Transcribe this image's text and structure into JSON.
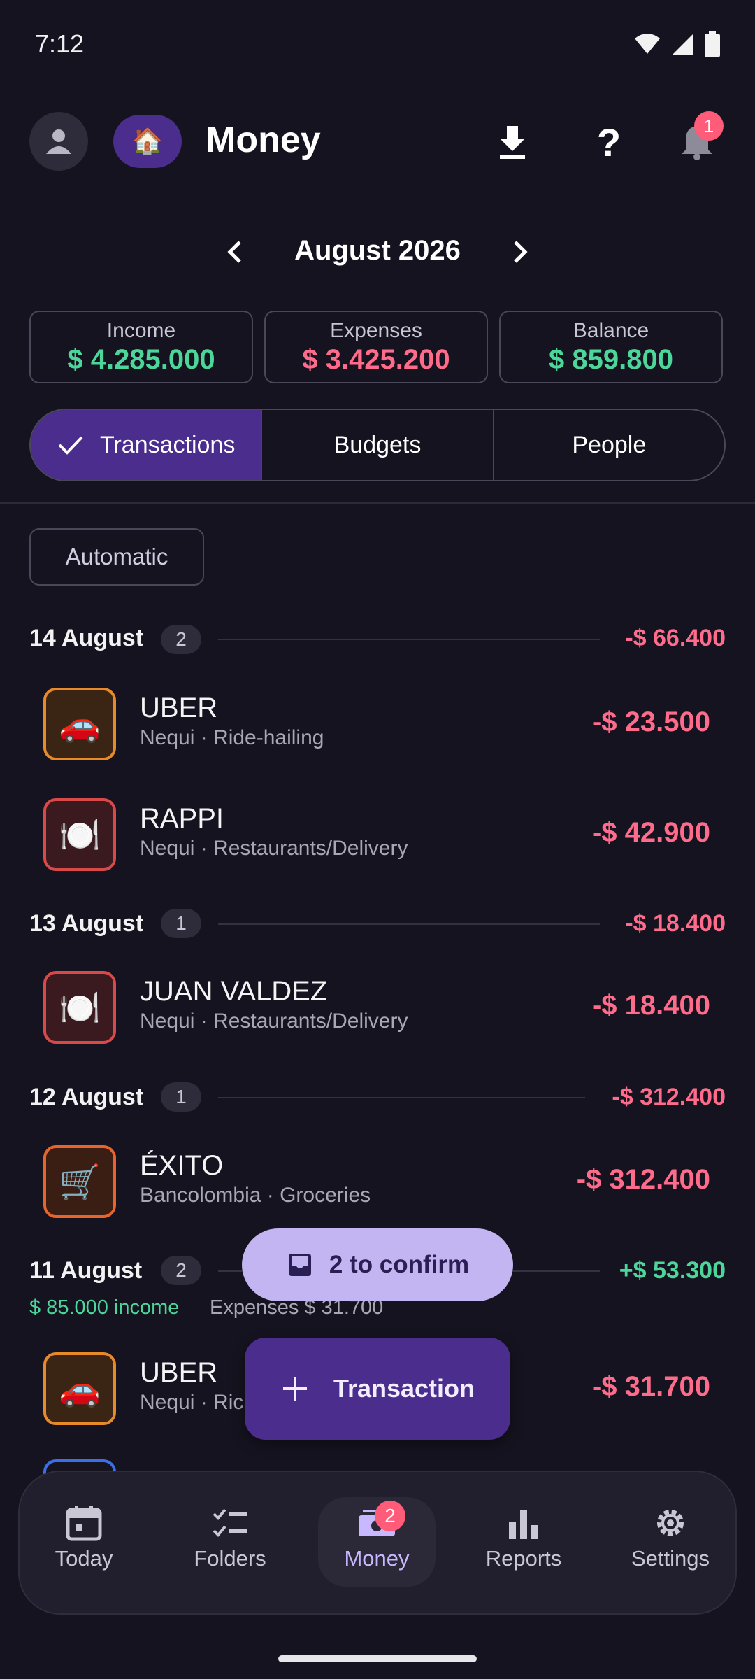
{
  "status_bar": {
    "time": "7:12"
  },
  "header": {
    "title": "Money",
    "home_emoji": "🏠",
    "notification_count": "1",
    "icons": [
      "avatar-icon",
      "download-icon",
      "help-icon",
      "bell-icon"
    ]
  },
  "month_nav": {
    "label": "August 2026"
  },
  "summary": {
    "income": {
      "label": "Income",
      "value": "$ 4.285.000"
    },
    "expenses": {
      "label": "Expenses",
      "value": "$ 3.425.200"
    },
    "balance": {
      "label": "Balance",
      "value": "$ 859.800"
    }
  },
  "tabs": [
    {
      "label": "Transactions",
      "selected": true
    },
    {
      "label": "Budgets"
    },
    {
      "label": "People"
    }
  ],
  "filter_chip": "Automatic",
  "days": [
    {
      "date": "14 August",
      "count": "2",
      "total": "-$ 66.400"
    },
    {
      "date": "13 August",
      "count": "1",
      "total": "-$ 18.400"
    },
    {
      "date": "12 August",
      "count": "1",
      "total": "-$ 312.400"
    },
    {
      "date": "11 August",
      "count": "2",
      "total": "+$ 53.300",
      "income_note": "$ 85.000 income",
      "expense_note": "Expenses $ 31.700"
    }
  ],
  "transactions": [
    {
      "name": "UBER",
      "sub": "Nequi · Ride-hailing",
      "amount": "-$ 23.500",
      "emoji": "🚗"
    },
    {
      "name": "RAPPI",
      "sub": "Nequi · Restaurants/Delivery",
      "amount": "-$ 42.900",
      "emoji": "🍽️"
    },
    {
      "name": "JUAN VALDEZ",
      "sub": "Nequi · Restaurants/Delivery",
      "amount": "-$ 18.400",
      "emoji": "🍽️"
    },
    {
      "name": "ÉXITO",
      "sub": "Bancolombia · Groceries",
      "amount": "-$ 312.400",
      "emoji": "🛒"
    },
    {
      "name": "UBER",
      "sub": "Nequi · Ric",
      "amount": "-$ 31.700",
      "emoji": "🚗"
    }
  ],
  "confirm_button": "2 to confirm",
  "fab_label": "Transaction",
  "bottom_nav": {
    "items": [
      {
        "label": "Today"
      },
      {
        "label": "Folders"
      },
      {
        "label": "Money",
        "badge": "2"
      },
      {
        "label": "Reports"
      },
      {
        "label": "Settings"
      }
    ]
  },
  "colors": {
    "accent": "#4a2d8c",
    "income": "#4cd69a",
    "expense": "#ff6b8b",
    "background": "#15131f"
  }
}
